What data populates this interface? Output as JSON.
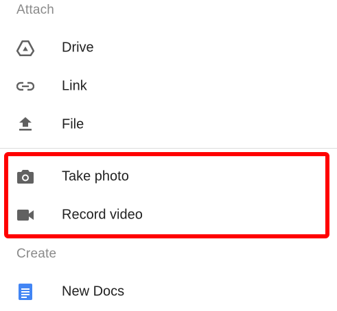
{
  "attach_section": {
    "header": "Attach",
    "items": [
      {
        "label": "Drive",
        "icon": "drive-icon"
      },
      {
        "label": "Link",
        "icon": "link-icon"
      },
      {
        "label": "File",
        "icon": "upload-icon"
      }
    ]
  },
  "media_section": {
    "items": [
      {
        "label": "Take photo",
        "icon": "camera-icon"
      },
      {
        "label": "Record video",
        "icon": "videocam-icon"
      }
    ]
  },
  "create_section": {
    "header": "Create",
    "items": [
      {
        "label": "New Docs",
        "icon": "docs-icon"
      }
    ]
  },
  "colors": {
    "icon_gray": "#616161",
    "docs_blue": "#4285f4",
    "highlight_red": "#ff0000"
  }
}
